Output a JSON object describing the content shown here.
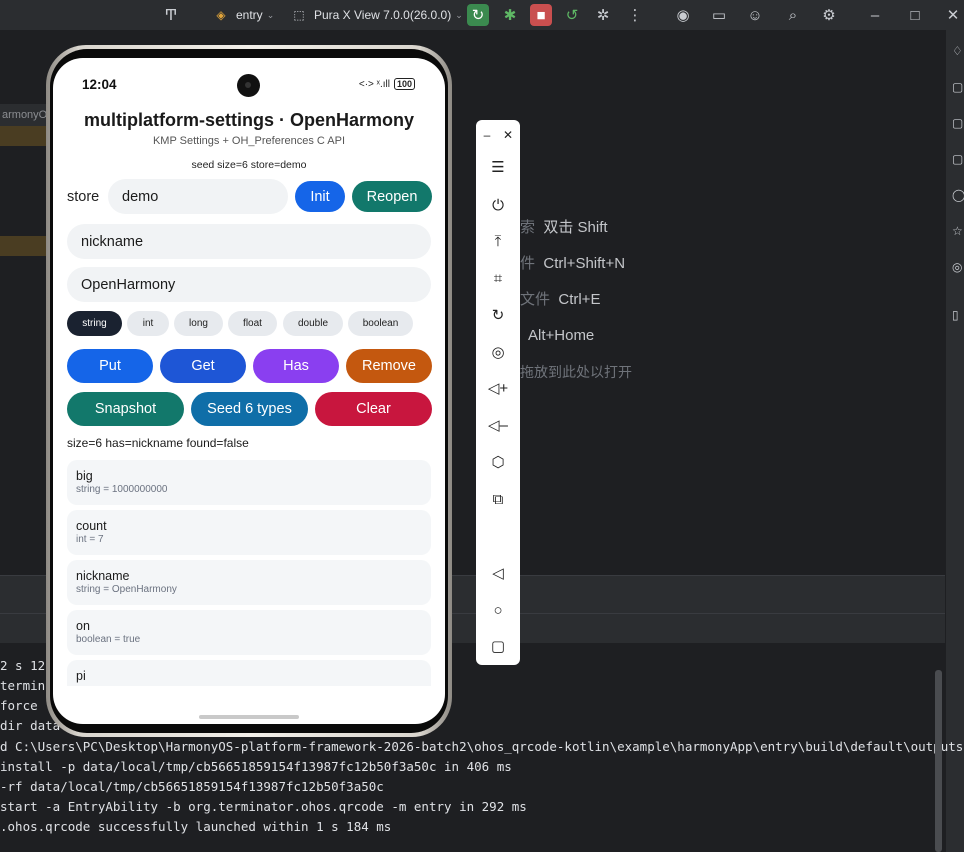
{
  "toolbar": {
    "module": "entry",
    "device": "Pura X View 7.0.0(26.0.0)"
  },
  "editor": {
    "tab_label": "armonyO",
    "hints": [
      {
        "prefix": "索",
        "action": "双击 Shift"
      },
      {
        "prefix": "件",
        "action": "Ctrl+Shift+N"
      },
      {
        "prefix": "文件",
        "action": "Ctrl+E"
      },
      {
        "prefix": "",
        "action": "Alt+Home"
      },
      {
        "prefix": "",
        "action": "拖放到此处以打开"
      }
    ]
  },
  "terminal": {
    "lines": [
      "2 s 12",
      "termin",
      " force",
      "dir data",
      "d C:\\Users\\PC\\Desktop\\HarmonyOS-platform-framework-2026-batch2\\ohos_qrcode-kotlin\\example\\harmonyApp\\entry\\build\\default\\outputs'",
      " install -p data/local/tmp/cb56651859154f13987fc12b50f3a50c in 406 ms",
      " -rf data/local/tmp/cb56651859154f13987fc12b50f3a50c",
      " start -a EntryAbility -b org.terminator.ohos.qrcode -m entry in 292 ms",
      ".ohos.qrcode successfully launched within 1 s 184 ms"
    ]
  },
  "phone": {
    "status": {
      "time": "12:04",
      "signal": "<·> ˣ.ıll",
      "battery": "100"
    },
    "title": "multiplatform-settings · OpenHarmony",
    "subtitle": "KMP Settings + OH_Preferences C API",
    "seed_info": "seed  size=6  store=demo",
    "store_label": "store",
    "store_value": "demo",
    "init_label": "Init",
    "reopen_label": "Reopen",
    "key_value": "nickname",
    "value_value": "OpenHarmony",
    "types": [
      "string",
      "int",
      "long",
      "float",
      "double",
      "boolean"
    ],
    "actions": {
      "put": "Put",
      "get": "Get",
      "has": "Has",
      "remove": "Remove",
      "snapshot": "Snapshot",
      "seed": "Seed 6 types",
      "clear": "Clear"
    },
    "status_line": "size=6  has=nickname found=false",
    "entries": [
      {
        "key": "big",
        "value": "string = 1000000000"
      },
      {
        "key": "count",
        "value": "int = 7"
      },
      {
        "key": "nickname",
        "value": "string = OpenHarmony"
      },
      {
        "key": "on",
        "value": "boolean = true"
      },
      {
        "key": "pi",
        "value": ""
      }
    ]
  },
  "colors": {
    "blue": "#1565e8",
    "teal": "#12786b",
    "purple": "#8a3ff0",
    "orange": "#c4580f",
    "ocean": "#0f6ea8",
    "crimson": "#c8163e"
  }
}
